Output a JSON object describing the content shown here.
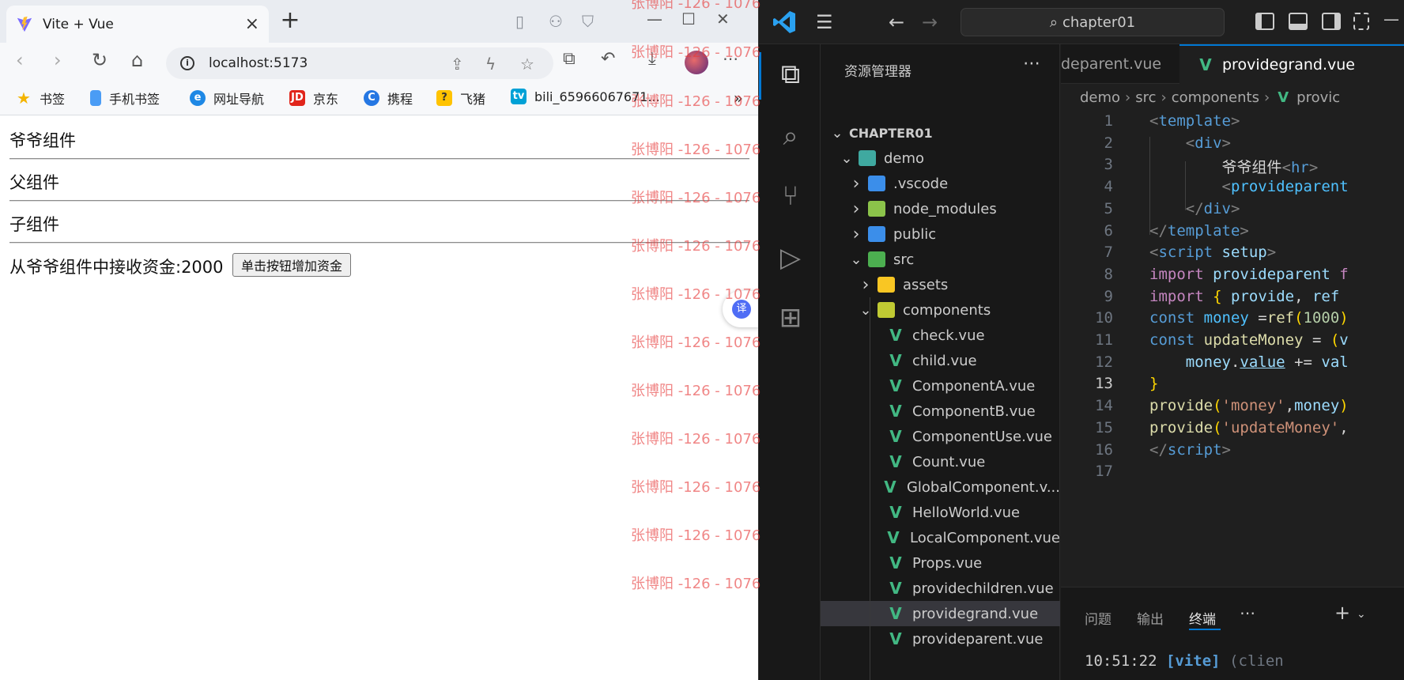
{
  "browser": {
    "tab_title": "Vite + Vue",
    "url": "localhost:5173",
    "bookmarks": [
      "书签",
      "手机书签",
      "网址导航",
      "京东",
      "携程",
      "飞猪",
      "bili_65966067671..."
    ],
    "page": {
      "grand_label": "爷爷组件",
      "parent_label": "父组件",
      "child_label": "子组件",
      "money_text": "从爷爷组件中接收资金:2000",
      "button_label": "单击按钮增加资金"
    },
    "translate_label": "译"
  },
  "watermark": "张博阳 -126 - 1076",
  "vscode": {
    "search_label": "chapter01",
    "explorer_title": "资源管理器",
    "tree": [
      {
        "label": "CHAPTER01",
        "depth": 0,
        "kind": "root",
        "expanded": true
      },
      {
        "label": "demo",
        "depth": 1,
        "kind": "folder-demo",
        "expanded": true
      },
      {
        "label": ".vscode",
        "depth": 2,
        "kind": "folder-vscode",
        "expanded": false
      },
      {
        "label": "node_modules",
        "depth": 2,
        "kind": "folder-node",
        "expanded": false
      },
      {
        "label": "public",
        "depth": 2,
        "kind": "folder-public",
        "expanded": false
      },
      {
        "label": "src",
        "depth": 2,
        "kind": "folder-src",
        "expanded": true
      },
      {
        "label": "assets",
        "depth": 3,
        "kind": "folder-assets",
        "expanded": false
      },
      {
        "label": "components",
        "depth": 3,
        "kind": "folder-components",
        "expanded": true
      },
      {
        "label": "check.vue",
        "depth": 4,
        "kind": "vue"
      },
      {
        "label": "child.vue",
        "depth": 4,
        "kind": "vue"
      },
      {
        "label": "ComponentA.vue",
        "depth": 4,
        "kind": "vue"
      },
      {
        "label": "ComponentB.vue",
        "depth": 4,
        "kind": "vue"
      },
      {
        "label": "ComponentUse.vue",
        "depth": 4,
        "kind": "vue"
      },
      {
        "label": "Count.vue",
        "depth": 4,
        "kind": "vue"
      },
      {
        "label": "GlobalComponent.v...",
        "depth": 4,
        "kind": "vue"
      },
      {
        "label": "HelloWorld.vue",
        "depth": 4,
        "kind": "vue"
      },
      {
        "label": "LocalComponent.vue",
        "depth": 4,
        "kind": "vue"
      },
      {
        "label": "Props.vue",
        "depth": 4,
        "kind": "vue"
      },
      {
        "label": "providechildren.vue",
        "depth": 4,
        "kind": "vue"
      },
      {
        "label": "providegrand.vue",
        "depth": 4,
        "kind": "vue",
        "selected": true
      },
      {
        "label": "provideparent.vue",
        "depth": 4,
        "kind": "vue"
      }
    ],
    "tabs": {
      "inactive": "deparent.vue",
      "active": "providegrand.vue"
    },
    "breadcrumb": [
      "demo",
      "src",
      "components",
      "provic"
    ],
    "current_line": 13,
    "code_lines": [
      [
        [
          "t-br",
          "<"
        ],
        [
          "t-tag",
          "template"
        ],
        [
          "t-br",
          ">"
        ]
      ],
      [
        [
          "t-txt",
          "    "
        ],
        [
          "t-br",
          "<"
        ],
        [
          "t-tag",
          "div"
        ],
        [
          "t-br",
          ">"
        ]
      ],
      [
        [
          "t-txt",
          "        爷爷组件"
        ],
        [
          "t-br",
          "<"
        ],
        [
          "t-tag",
          "hr"
        ],
        [
          "t-br",
          ">"
        ]
      ],
      [
        [
          "t-txt",
          "        "
        ],
        [
          "t-br",
          "<"
        ],
        [
          "t-cn",
          "provideparent"
        ]
      ],
      [
        [
          "t-txt",
          "    "
        ],
        [
          "t-br",
          "</"
        ],
        [
          "t-tag",
          "div"
        ],
        [
          "t-br",
          ">"
        ]
      ],
      [
        [
          "t-br",
          "</"
        ],
        [
          "t-tag",
          "template"
        ],
        [
          "t-br",
          ">"
        ]
      ],
      [
        [
          "t-br",
          "<"
        ],
        [
          "t-tag",
          "script"
        ],
        [
          "t-txt",
          " "
        ],
        [
          "t-id",
          "setup"
        ],
        [
          "t-br",
          ">"
        ]
      ],
      [
        [
          "t-kw",
          "import"
        ],
        [
          "t-txt",
          " "
        ],
        [
          "t-id",
          "provideparent"
        ],
        [
          "t-txt",
          " "
        ],
        [
          "t-kw",
          "f"
        ]
      ],
      [
        [
          "t-kw",
          "import"
        ],
        [
          "t-txt",
          " "
        ],
        [
          "t-y",
          "{"
        ],
        [
          "t-txt",
          " "
        ],
        [
          "t-id",
          "provide"
        ],
        [
          "t-txt",
          ", "
        ],
        [
          "t-id",
          "ref"
        ]
      ],
      [
        [
          "t-st",
          "const"
        ],
        [
          "t-txt",
          " "
        ],
        [
          "t-cn",
          "money"
        ],
        [
          "t-txt",
          " ="
        ],
        [
          "t-fn",
          "ref"
        ],
        [
          "t-y",
          "("
        ],
        [
          "t-num",
          "1000"
        ],
        [
          "t-y",
          ")"
        ]
      ],
      [
        [
          "t-st",
          "const"
        ],
        [
          "t-txt",
          " "
        ],
        [
          "t-fn",
          "updateMoney"
        ],
        [
          "t-txt",
          " = "
        ],
        [
          "t-y",
          "("
        ],
        [
          "t-id",
          "v"
        ]
      ],
      [
        [
          "t-txt",
          "    "
        ],
        [
          "t-id",
          "money"
        ],
        [
          "t-txt",
          "."
        ],
        [
          "t-id",
          "value"
        ],
        [
          "t-txt",
          " += "
        ],
        [
          "t-id",
          "val"
        ]
      ],
      [
        [
          "t-y",
          "}"
        ]
      ],
      [
        [
          "t-fn",
          "provide"
        ],
        [
          "t-y",
          "("
        ],
        [
          "t-str",
          "'money'"
        ],
        [
          "t-txt",
          ","
        ],
        [
          "t-id",
          "money"
        ],
        [
          "t-y",
          ")"
        ]
      ],
      [
        [
          "t-fn",
          "provide"
        ],
        [
          "t-y",
          "("
        ],
        [
          "t-str",
          "'updateMoney'"
        ],
        [
          "t-txt",
          ","
        ]
      ],
      [
        [
          "t-br",
          "</"
        ],
        [
          "t-tag",
          "script"
        ],
        [
          "t-br",
          ">"
        ]
      ],
      []
    ],
    "panel": {
      "tabs": [
        "问题",
        "输出",
        "终端"
      ],
      "active_tab": "终端",
      "terminal_time": "10:51:22",
      "terminal_tag": "[vite]",
      "terminal_rest": "(clien"
    }
  }
}
